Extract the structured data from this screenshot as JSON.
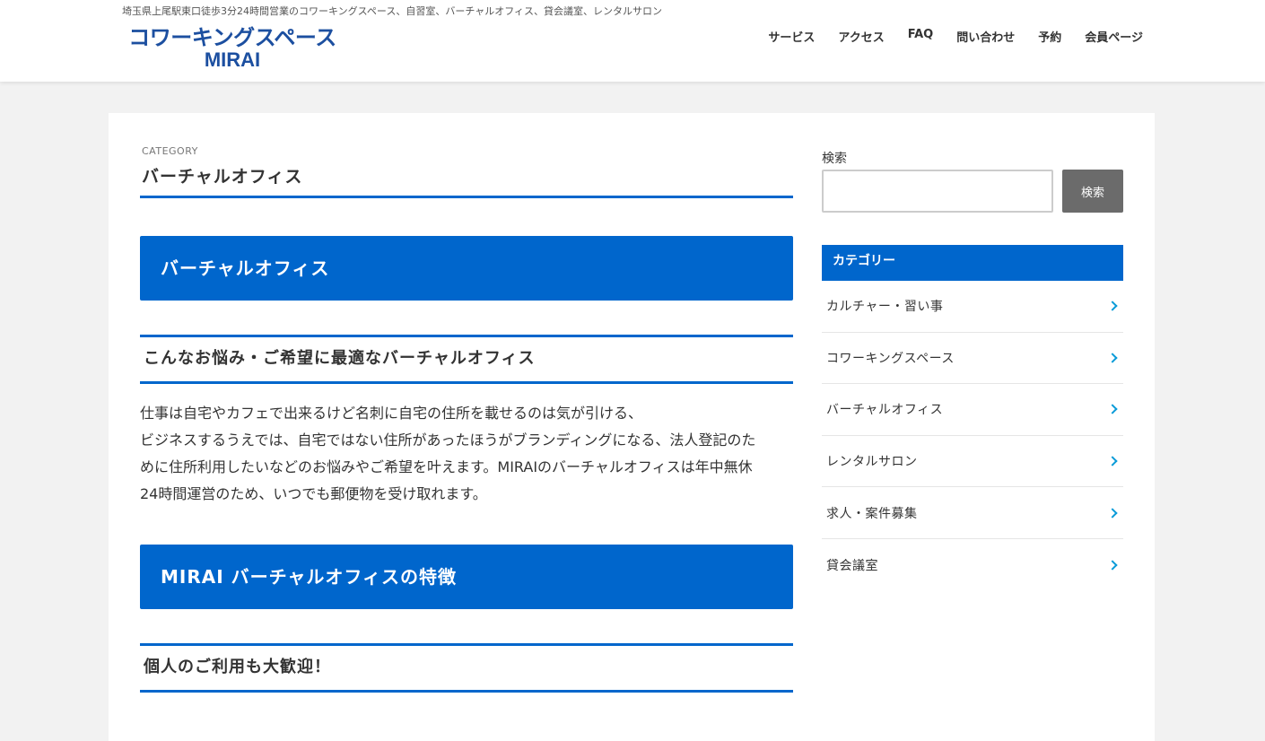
{
  "header": {
    "tagline": "埼玉県上尾駅東口徒歩3分24時間営業のコワーキングスペース、自習室、バーチャルオフィス、貸会議室、レンタルサロン",
    "logo_main": "コワーキングスペース",
    "logo_sub": "MIRAI",
    "nav": [
      "サービス",
      "アクセス",
      "FAQ",
      "問い合わせ",
      "予約",
      "会員ページ"
    ]
  },
  "main": {
    "category_label": "CATEGORY",
    "category_title": "バーチャルオフィス",
    "heading_1": "バーチャルオフィス",
    "subheading_1": "こんなお悩み・ご希望に最適なバーチャルオフィス",
    "paragraph_lines": [
      "仕事は自宅やカフェで出来るけど名刺に自宅の住所を載せるのは気が引ける、",
      "ビジネスするうえでは、自宅ではない住所があったほうがブランディングになる、法人登記のた",
      "めに住所利用したいなどのお悩みやご希望を叶えます。MIRAIのバーチャルオフィスは年中無休",
      "24時間運営のため、いつでも郵便物を受け取れます。"
    ],
    "heading_2": "MIRAI バーチャルオフィスの特徴",
    "subheading_2": "個人のご利用も大歓迎！"
  },
  "sidebar": {
    "search_label": "検索",
    "search_button": "検索",
    "search_value": "",
    "category_widget_title": "カテゴリー",
    "categories": [
      "カルチャー・習い事",
      "コワーキングスペース",
      "バーチャルオフィス",
      "レンタルサロン",
      "求人・案件募集",
      "貸会議室"
    ]
  },
  "colors": {
    "accent": "#0066cc",
    "logo": "#1c4fa0",
    "chevron": "#0a9bd8",
    "search_button": "#6b6b6b",
    "page_background": "#f2f2f2"
  }
}
